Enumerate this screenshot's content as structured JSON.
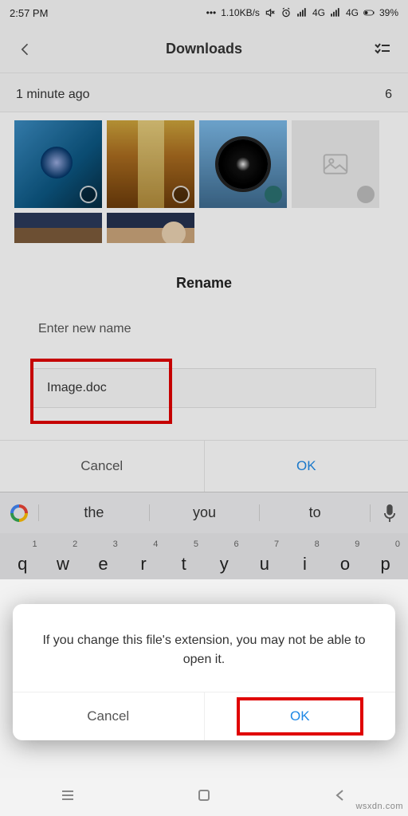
{
  "status": {
    "time": "2:57 PM",
    "speed": "1.10KB/s",
    "net1": "4G",
    "net2": "4G",
    "battery": "39%"
  },
  "header": {
    "title": "Downloads"
  },
  "section": {
    "label": "1 minute ago",
    "count": "6"
  },
  "rename": {
    "title": "Rename",
    "label": "Enter new name",
    "value": "Image.doc",
    "cancel": "Cancel",
    "ok": "OK"
  },
  "keyboard": {
    "sugg1": "the",
    "sugg2": "you",
    "sugg3": "to",
    "row1": [
      {
        "k": "q",
        "n": "1"
      },
      {
        "k": "w",
        "n": "2"
      },
      {
        "k": "e",
        "n": "3"
      },
      {
        "k": "r",
        "n": "4"
      },
      {
        "k": "t",
        "n": "5"
      },
      {
        "k": "y",
        "n": "6"
      },
      {
        "k": "u",
        "n": "7"
      },
      {
        "k": "i",
        "n": "8"
      },
      {
        "k": "o",
        "n": "9"
      },
      {
        "k": "p",
        "n": "0"
      }
    ]
  },
  "modal": {
    "message": "If you change this file's extension, you may not be able to open it.",
    "cancel": "Cancel",
    "ok": "OK"
  },
  "watermark": "wsxdn.com"
}
